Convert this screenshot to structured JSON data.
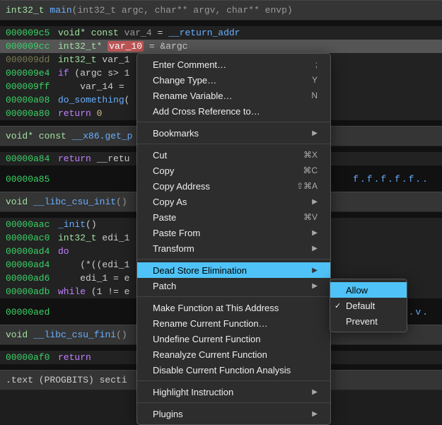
{
  "main_sig": {
    "type": "int32_t",
    "name": "main",
    "params": "(int32_t argc, char** argv, char** envp)"
  },
  "lines": [
    {
      "addr": "000009c5",
      "cls": "",
      "html": "<span class='type'>void* const</span> <span class='gray'>var_4</span> = <span class='fn'>__return_addr</span>"
    },
    {
      "addr": "000009cc",
      "cls": "sel",
      "html": "<span class='type'>int32_t*</span> <span class='varred'>var_10</span> = &argc"
    },
    {
      "addr": "000009dd",
      "cls": "",
      "addrcls": "dim",
      "html": "<span class='type'>int32_t</span> var_1"
    },
    {
      "addr": "000009e4",
      "cls": "",
      "html": "<span class='kw'>if</span> (argc s&gt; 1"
    },
    {
      "addr": "000009ff",
      "cls": "",
      "html": "&nbsp;&nbsp;&nbsp;&nbsp;var_14 = "
    },
    {
      "addr": "00000a08",
      "cls": "",
      "html": "<span class='fn'>do_something</span>("
    },
    {
      "addr": "00000a80",
      "cls": "",
      "html": "<span class='kw'>return</span> <span class='str'>0</span>"
    }
  ],
  "sig2": {
    "type": "void* const",
    "name": "__x86.get_p"
  },
  "line2": {
    "addr": "00000a84",
    "html": "<span class='kw'>return</span> __retu"
  },
  "hex1": {
    "addr": "00000a85",
    "data": "f.f.f.f.f.."
  },
  "sig3": {
    "type": "void",
    "name": "__libc_csu_init",
    "params": "()"
  },
  "lines3": [
    {
      "addr": "00000aac",
      "html": "<span class='fn'>_init</span>()"
    },
    {
      "addr": "00000ac0",
      "html": "<span class='type'>int32_t</span> edi_1"
    },
    {
      "addr": "00000ad4",
      "html": "<span class='kw'>do</span>"
    },
    {
      "addr": "00000ad4",
      "html": "&nbsp;&nbsp;&nbsp;&nbsp;(*((edi_1"
    },
    {
      "addr": "00000ad6",
      "html": "&nbsp;&nbsp;&nbsp;&nbsp;edi_1 = e"
    },
    {
      "addr": "00000adb",
      "html": "<span class='kw'>while</span> (1 != e"
    }
  ],
  "hex2": {
    "addr": "00000aed",
    "data": ".v."
  },
  "sig4": {
    "type": "void",
    "name": "__libc_csu_fini",
    "params": "()"
  },
  "line4": {
    "addr": "00000af0",
    "html": "<span class='kw'>return</span>"
  },
  "section": {
    "text": ".text (PROGBITS) secti"
  },
  "menu": [
    {
      "t": "item",
      "label": "Enter Comment…",
      "sh": ";"
    },
    {
      "t": "item",
      "label": "Change Type…",
      "sh": "Y"
    },
    {
      "t": "item",
      "label": "Rename Variable…",
      "sh": "N"
    },
    {
      "t": "item",
      "label": "Add Cross Reference to…"
    },
    {
      "t": "sep"
    },
    {
      "t": "sub",
      "label": "Bookmarks"
    },
    {
      "t": "sep"
    },
    {
      "t": "item",
      "label": "Cut",
      "sh": "⌘X"
    },
    {
      "t": "item",
      "label": "Copy",
      "sh": "⌘C"
    },
    {
      "t": "item",
      "label": "Copy Address",
      "sh": "⇧⌘A"
    },
    {
      "t": "sub",
      "label": "Copy As"
    },
    {
      "t": "item",
      "label": "Paste",
      "sh": "⌘V"
    },
    {
      "t": "sub",
      "label": "Paste From"
    },
    {
      "t": "sub",
      "label": "Transform"
    },
    {
      "t": "sep"
    },
    {
      "t": "sub",
      "label": "Dead Store Elimination",
      "hi": true
    },
    {
      "t": "sub",
      "label": "Patch"
    },
    {
      "t": "sep"
    },
    {
      "t": "item",
      "label": "Make Function at This Address"
    },
    {
      "t": "item",
      "label": "Rename Current Function…"
    },
    {
      "t": "item",
      "label": "Undefine Current Function"
    },
    {
      "t": "item",
      "label": "Reanalyze Current Function"
    },
    {
      "t": "item",
      "label": "Disable Current Function Analysis"
    },
    {
      "t": "sep"
    },
    {
      "t": "sub",
      "label": "Highlight Instruction"
    },
    {
      "t": "sep"
    },
    {
      "t": "sub",
      "label": "Plugins"
    }
  ],
  "submenu": [
    {
      "label": "Allow",
      "hi": true
    },
    {
      "label": "Default",
      "check": true
    },
    {
      "label": "Prevent"
    }
  ]
}
